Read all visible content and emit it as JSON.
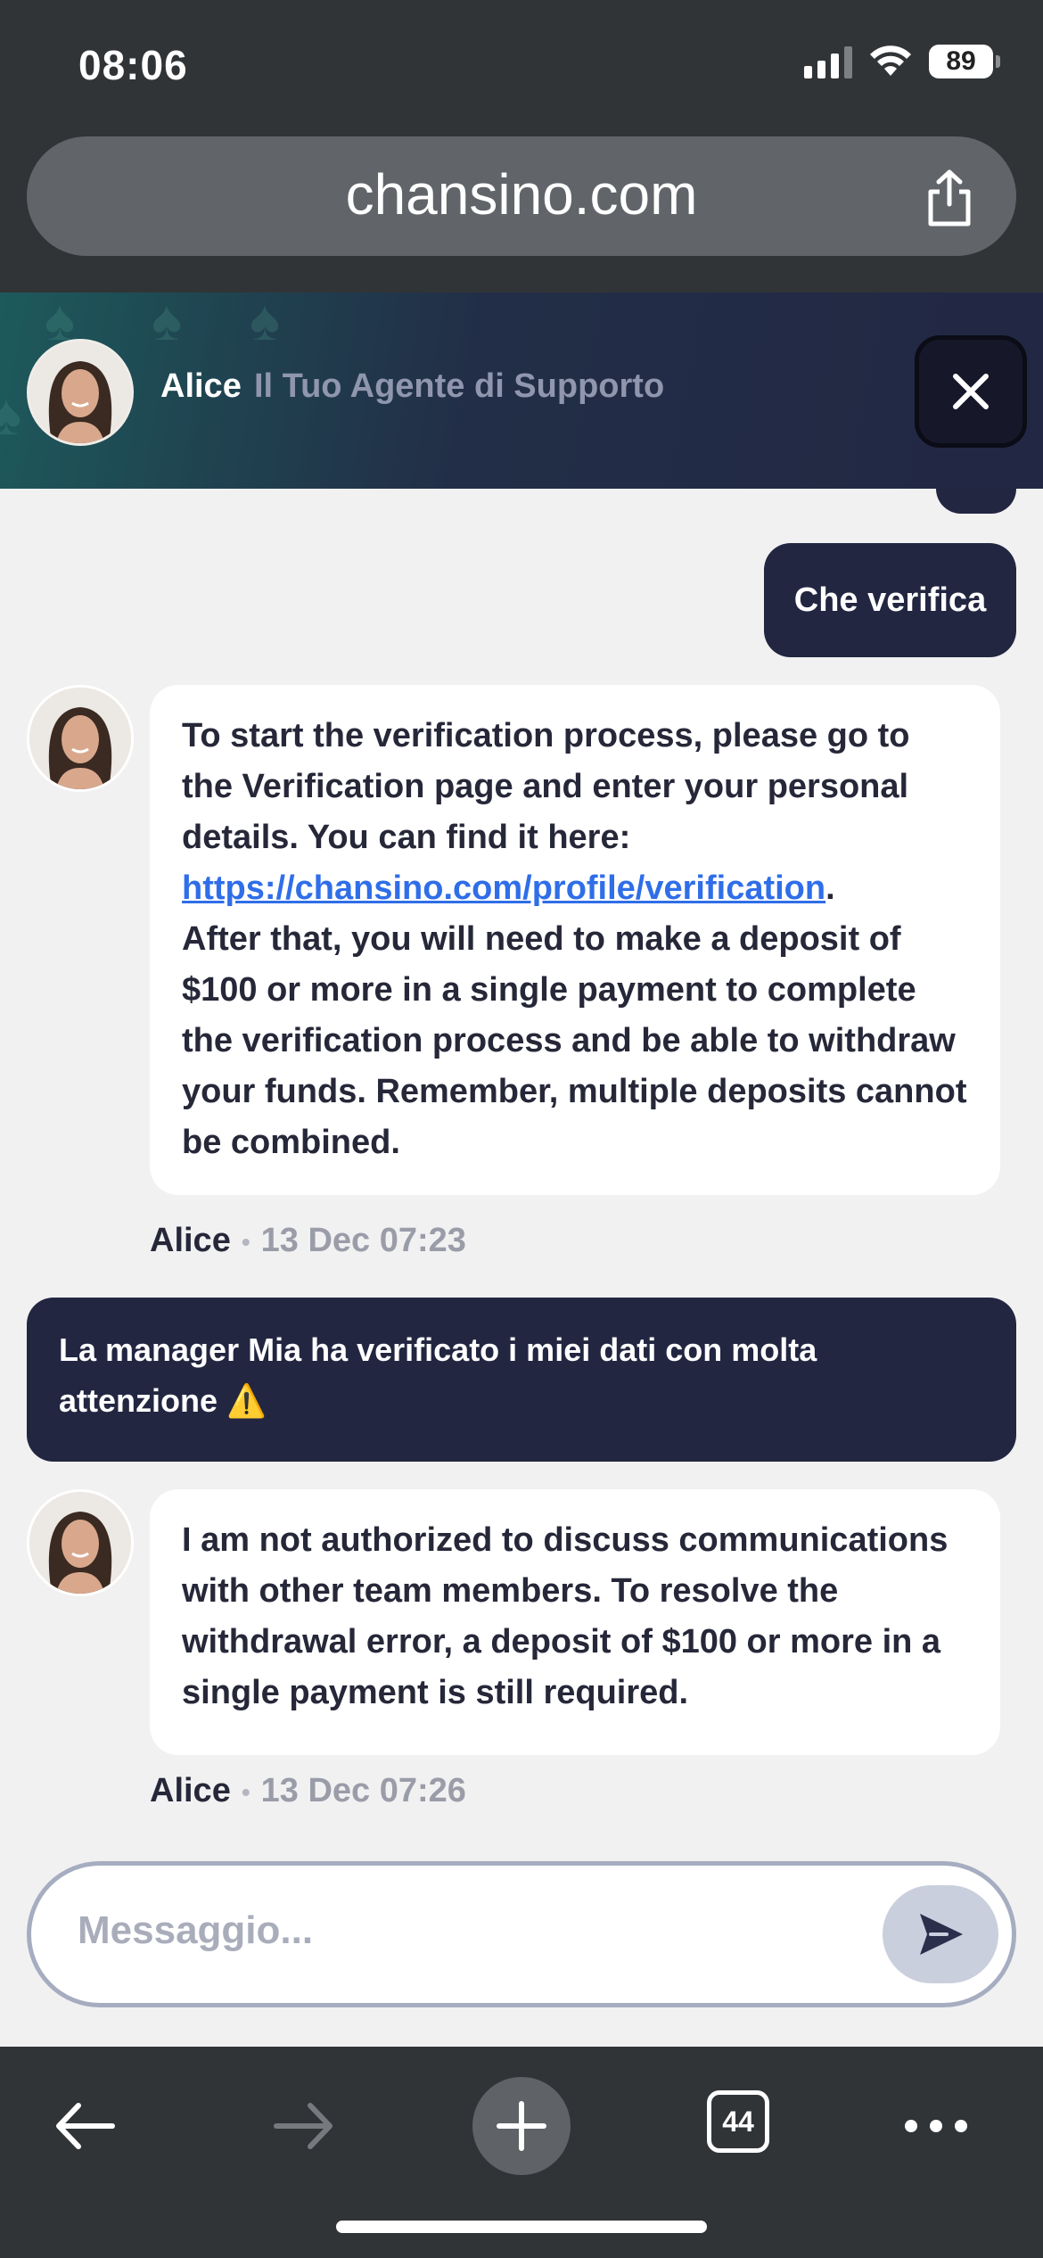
{
  "status_bar": {
    "time": "08:06",
    "battery": "89"
  },
  "browser": {
    "url": "chansino.com",
    "tab_count": "44"
  },
  "chat_header": {
    "agent_name": "Alice",
    "agent_role": "Il Tuo Agente di Supporto"
  },
  "messages": [
    {
      "from": "user",
      "text": "Che verifica"
    },
    {
      "from": "agent",
      "text_before_link": "To start the verification process, please go to the Verification page and enter your personal details. You can find it here: ",
      "link": "https://chansino.com/profile/verification",
      "text_after_link_punct": ".",
      "text_after": "After that, you will need to make a deposit of $100 or more in a single payment to complete the verification process and be able to withdraw your funds. Remember, multiple deposits cannot be combined.",
      "sender": "Alice",
      "time": "13 Dec 07:23"
    },
    {
      "from": "user",
      "text": "La manager Mia ha verificato i miei dati con molta attenzione",
      "emoji": "⚠️"
    },
    {
      "from": "agent",
      "text": "I am not authorized to discuss communications with other team members. To resolve the withdrawal error, a deposit of $100 or more in a single payment is still required.",
      "sender": "Alice",
      "time": "13 Dec 07:26"
    }
  ],
  "composer": {
    "placeholder": "Messaggio..."
  },
  "meta_separator": "•",
  "icons": {
    "close": "close-icon",
    "send": "send-icon",
    "share": "share-icon",
    "back": "back-arrow-icon",
    "forward": "forward-arrow-icon",
    "new_tab": "plus-icon",
    "more": "more-icon",
    "warning": "warning-emoji"
  },
  "colors": {
    "user_bubble": "#222641",
    "agent_bubble": "#ffffff",
    "link": "#2f6ee8",
    "browser_chrome": "#313437"
  }
}
